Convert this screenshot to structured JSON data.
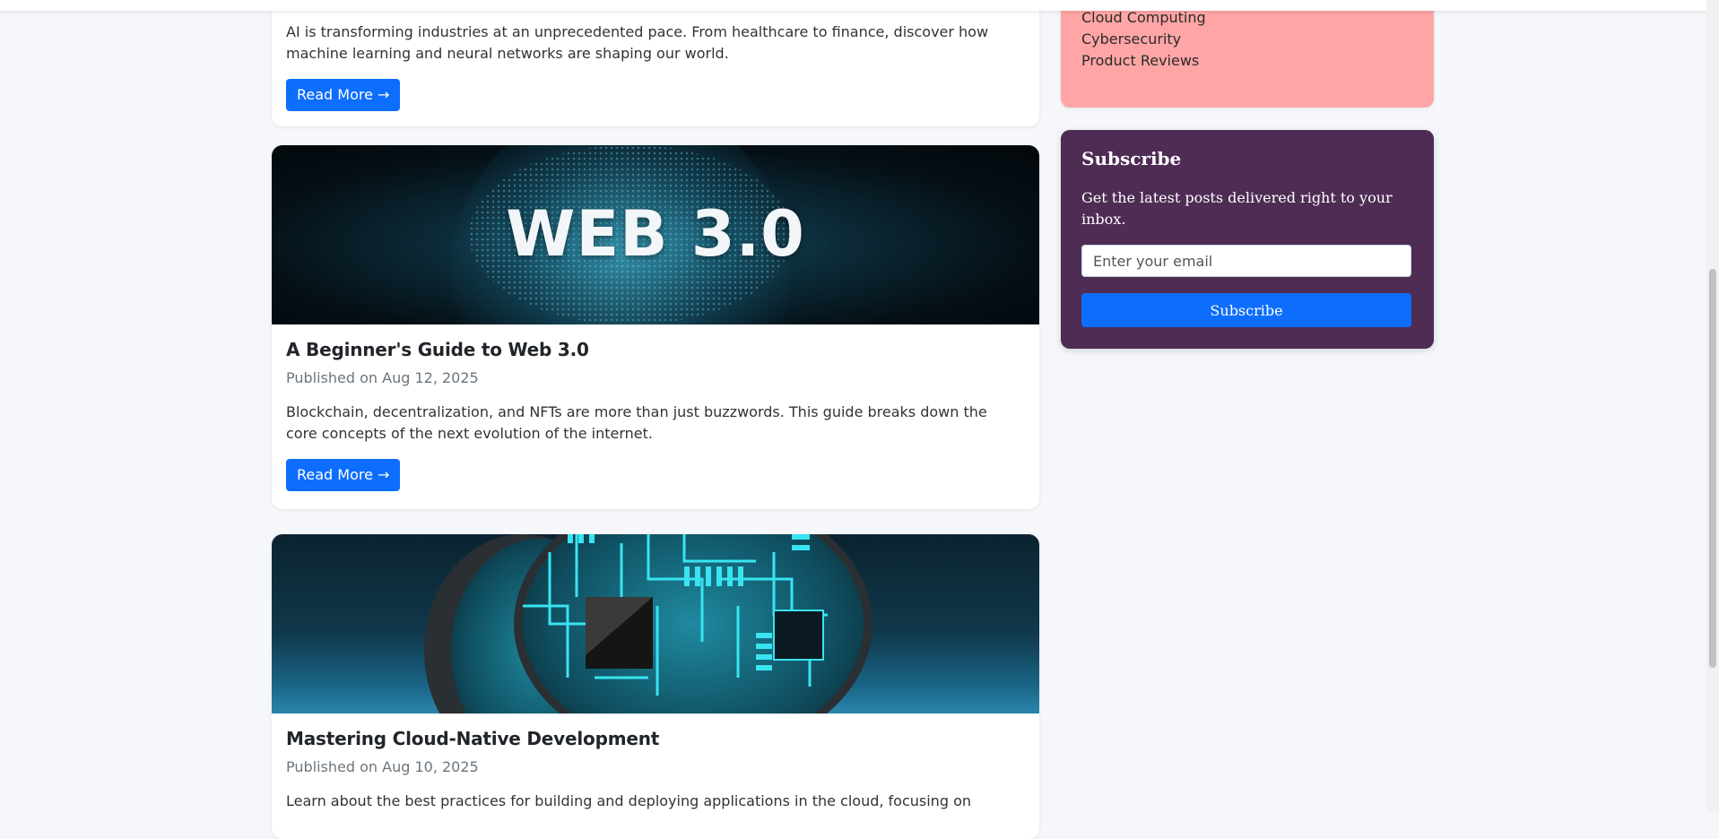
{
  "posts": [
    {
      "excerpt": "AI is transforming industries at an unprecedented pace. From healthcare to finance, discover how machine learning and neural networks are shaping our world.",
      "read_more": "Read More →"
    },
    {
      "image_text": "WEB 3.0",
      "title": "A Beginner's Guide to Web 3.0",
      "date": "Published on Aug 12, 2025",
      "excerpt": "Blockchain, decentralization, and NFTs are more than just buzzwords. This guide breaks down the core concepts of the next evolution of the internet.",
      "read_more": "Read More →"
    },
    {
      "title": "Mastering Cloud-Native Development",
      "date": "Published on Aug 10, 2025",
      "excerpt": "Learn about the best practices for building and deploying applications in the cloud, focusing on"
    }
  ],
  "sidebar": {
    "categories": [
      "Cloud Computing",
      "Cybersecurity",
      "Product Reviews"
    ],
    "subscribe": {
      "title": "Subscribe",
      "text": "Get the latest posts delivered right to your inbox.",
      "placeholder": "Enter your email",
      "button": "Subscribe"
    }
  },
  "colors": {
    "primary": "#0d6efd",
    "categories_bg": "#ffa5a5",
    "subscribe_bg": "#4e2c54"
  }
}
